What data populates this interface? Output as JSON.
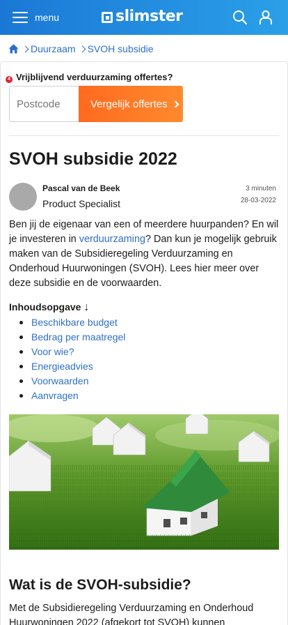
{
  "header": {
    "menu_label": "menu",
    "logo_text": "slimster",
    "icons": [
      "hamburger-icon",
      "search-icon",
      "user-icon"
    ],
    "brand_color": "#1b78d6"
  },
  "breadcrumb": {
    "home_icon": "home-icon",
    "items": [
      "Duurzaam",
      "SVOH subsidie"
    ]
  },
  "offer_form": {
    "badge": "4",
    "title": "Vrijblijvend verduurzaming offertes?",
    "postcode_placeholder": "Postcode",
    "cta_label": "Vergelijk offertes",
    "cta_color": "#ff6a1f"
  },
  "article": {
    "title": "SVOH subsidie 2022",
    "author_name": "Pascal van de Beek",
    "author_role": "Product Specialist",
    "read_time": "3 minuten",
    "date": "28-03-2022",
    "intro_part1": "Ben jij de eigenaar van een of meerdere huurpanden? En wil je investeren in ",
    "intro_link": "verduurzaming",
    "intro_part2": "? Dan kun je mogelijk gebruik maken van de Subsidieregeling Verduurzaming en Onderhoud Huurwoningen (SVOH). Lees hier meer over deze subsidie en de voorwaarden.",
    "toc_title": "Inhoudsopgave",
    "toc_arrow": "↓",
    "toc_items": [
      "Beschikbare budget",
      "Bedrag per maatregel",
      "Voor wie?",
      "Energieadvies",
      "Voorwaarden",
      "Aanvragen"
    ],
    "section_title": "Wat is de SVOH-subsidie?",
    "section_para": "Met de Subsidieregeling Verduurzaming en Onderhoud Huurwoningen 2022 (afgekort tot SVOH) kunnen"
  }
}
